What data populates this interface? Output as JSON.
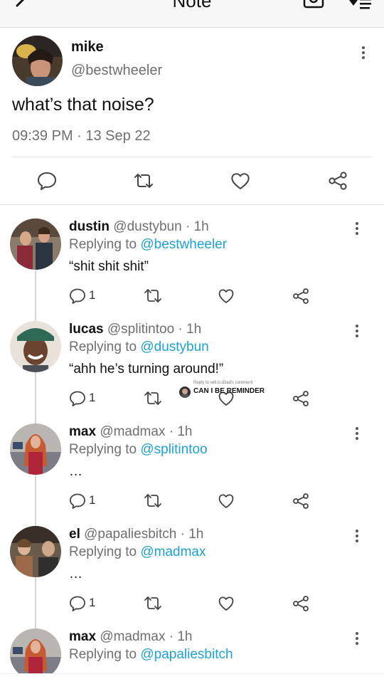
{
  "topbar": {
    "title": "Note"
  },
  "main_post": {
    "name": "mike",
    "handle": "@bestwheeler",
    "text": "what’s that noise?",
    "timestamp": "09:39 PM · 13 Sep 22"
  },
  "replies": [
    {
      "name": "dustin",
      "handle": "@dustybun",
      "time": "· 1h",
      "replying_prefix": "Replying to",
      "replying_to": "@bestwheeler",
      "text": "“shit shit shit”",
      "reply_count": "1"
    },
    {
      "name": "lucas",
      "handle": "@splitintoo",
      "time": "· 1h",
      "replying_prefix": "Replying to",
      "replying_to": "@dustybun",
      "text": "“ahh he’s turning around!”",
      "reply_count": "1"
    },
    {
      "name": "max",
      "handle": "@madmax",
      "time": "· 1h",
      "replying_prefix": "Replying to",
      "replying_to": "@splitintoo",
      "text": "…",
      "reply_count": "1"
    },
    {
      "name": "el",
      "handle": "@papaliesbitch",
      "time": "· 1h",
      "replying_prefix": "Replying to",
      "replying_to": "@madmax",
      "text": "…",
      "reply_count": "1"
    },
    {
      "name": "max",
      "handle": "@madmax",
      "time": "· 1h",
      "replying_prefix": "Replying to",
      "replying_to": "@papaliesbitch",
      "text": "",
      "reply_count": ""
    }
  ],
  "overlay": {
    "small": "Reply to will.is.d3ad's comment",
    "big": "CAN I BE REMINDER"
  },
  "colors": {
    "link": "#1da1d4",
    "muted": "#6f6f6f",
    "icon": "#444444"
  }
}
